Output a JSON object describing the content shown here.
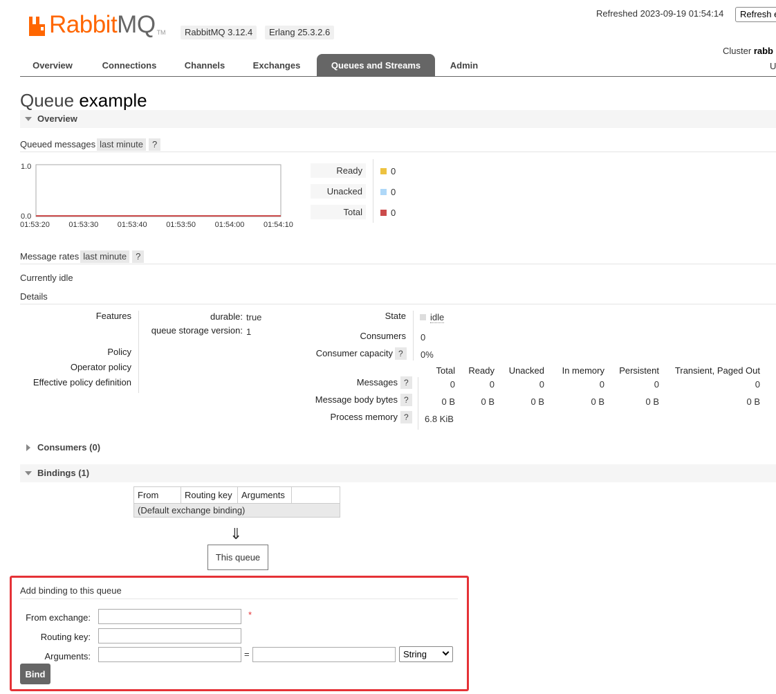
{
  "header": {
    "logo_text_rabbit": "Rabbit",
    "logo_text_mq": "MQ",
    "logo_tm": "TM",
    "version_badge": "RabbitMQ 3.12.4",
    "erlang_badge": "Erlang 25.3.2.6",
    "refreshed_label": "Refreshed 2023-09-19 01:54:14",
    "refresh_button": "Refresh e",
    "cluster_label": "Cluster",
    "cluster_name": "rabb",
    "user_fragment": "U"
  },
  "nav": {
    "tabs": [
      {
        "label": "Overview"
      },
      {
        "label": "Connections"
      },
      {
        "label": "Channels"
      },
      {
        "label": "Exchanges"
      },
      {
        "label": "Queues and Streams",
        "active": true
      },
      {
        "label": "Admin"
      }
    ]
  },
  "page": {
    "title_kind": "Queue",
    "title_name": "example"
  },
  "overview": {
    "section_title": "Overview",
    "queued_messages": {
      "label": "Queued messages",
      "range": "last minute",
      "help": "?"
    },
    "legend": [
      {
        "label": "Ready",
        "value": "0",
        "color": "#edc240"
      },
      {
        "label": "Unacked",
        "value": "0",
        "color": "#afd8f8"
      },
      {
        "label": "Total",
        "value": "0",
        "color": "#cb4b4b"
      }
    ],
    "message_rates": {
      "label": "Message rates",
      "range": "last minute",
      "help": "?"
    },
    "idle_text": "Currently idle",
    "details_label": "Details"
  },
  "chart_data": {
    "type": "line",
    "x": [
      "01:53:20",
      "01:53:30",
      "01:53:40",
      "01:53:50",
      "01:54:00",
      "01:54:10"
    ],
    "series": [
      {
        "name": "Ready",
        "values": [
          0,
          0,
          0,
          0,
          0,
          0
        ],
        "color": "#edc240"
      },
      {
        "name": "Unacked",
        "values": [
          0,
          0,
          0,
          0,
          0,
          0
        ],
        "color": "#afd8f8"
      },
      {
        "name": "Total",
        "values": [
          0,
          0,
          0,
          0,
          0,
          0
        ],
        "color": "#cb4b4b"
      }
    ],
    "yticks": [
      "1.0",
      "0.0"
    ],
    "ylim": [
      0,
      1
    ],
    "grid": false
  },
  "details": {
    "features_label": "Features",
    "features": [
      {
        "key": "durable:",
        "value": "true"
      },
      {
        "key": "queue storage version:",
        "value": "1"
      }
    ],
    "policy_label": "Policy",
    "operator_policy_label": "Operator policy",
    "effective_policy_label": "Effective policy definition",
    "state_label": "State",
    "state_value": "idle",
    "consumers_label": "Consumers",
    "consumers_value": "0",
    "consumer_capacity_label": "Consumer capacity",
    "consumer_capacity_value": "0%",
    "help": "?",
    "stats_columns": [
      "Total",
      "Ready",
      "Unacked",
      "In memory",
      "Persistent",
      "Transient, Paged Out"
    ],
    "messages_label": "Messages",
    "messages_values": [
      "0",
      "0",
      "0",
      "0",
      "0",
      "0"
    ],
    "body_bytes_label": "Message body bytes",
    "body_bytes_values": [
      "0 B",
      "0 B",
      "0 B",
      "0 B",
      "0 B",
      "0 B"
    ],
    "process_memory_label": "Process memory",
    "process_memory_value": "6.8 KiB"
  },
  "consumers": {
    "section_title": "Consumers (0)"
  },
  "bindings": {
    "section_title": "Bindings (1)",
    "columns": [
      "From",
      "Routing key",
      "Arguments",
      ""
    ],
    "rows": [
      {
        "label": "(Default exchange binding)"
      }
    ],
    "arrow": "⇓",
    "this_queue": "This queue"
  },
  "add_binding": {
    "title": "Add binding to this queue",
    "from_exchange_label": "From exchange:",
    "from_exchange_value": "",
    "required_mark": "*",
    "routing_key_label": "Routing key:",
    "routing_key_value": "",
    "arguments_label": "Arguments:",
    "arguments_key_value": "",
    "equals": "=",
    "arguments_val_value": "",
    "type_selected": "String",
    "bind_button": "Bind"
  }
}
